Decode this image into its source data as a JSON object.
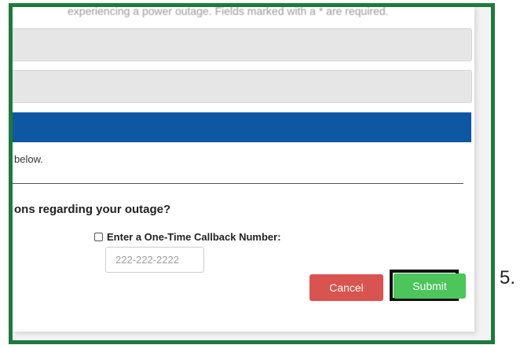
{
  "form": {
    "intro_text": "experiencing a power outage. Fields marked with a * are required.",
    "instruction_text": "below.",
    "question_text": "ons regarding your outage?",
    "callback_label": "Enter a One-Time Callback Number:",
    "callback_checked": false,
    "callback_placeholder": "222-222-2222",
    "cancel_label": "Cancel",
    "submit_label": "Submit"
  },
  "annotation": {
    "step_number": "5."
  },
  "colors": {
    "frame_border": "#1e7a3c",
    "header_bar": "#0e57a2",
    "cancel_button": "#d9534f",
    "submit_button": "#4cc55a",
    "highlight_box": "#111111"
  }
}
